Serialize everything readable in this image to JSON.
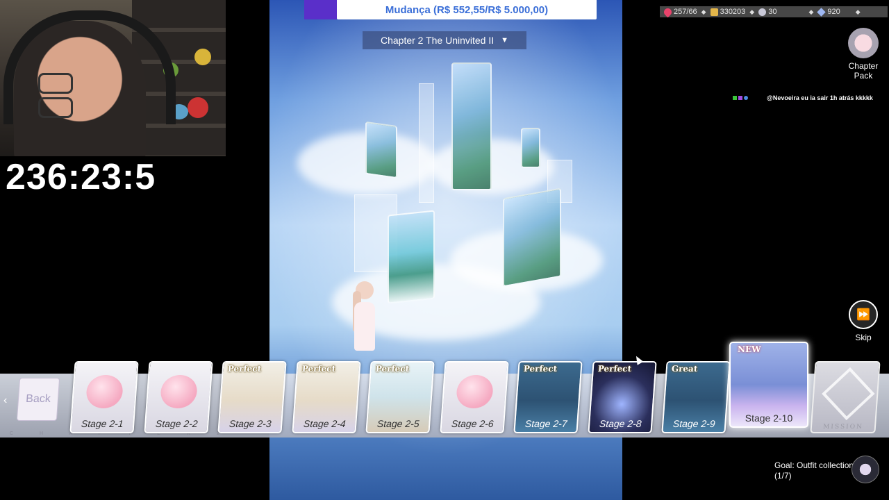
{
  "overlay": {
    "timer": "236:23:5",
    "donation_goal": "Mudança (R$ 552,55/R$ 5.000,00)",
    "chat_message": {
      "text": "@Nevoeira eu ia sair 1h atrás kkkkk"
    }
  },
  "game": {
    "chapter_selector": "Chapter 2 The Uninvited II",
    "resources": [
      {
        "icon": "heart-icon",
        "value": "257/66",
        "color": "#e8436b"
      },
      {
        "icon": "gold-coin-icon",
        "value": "330203",
        "color": "#e3b64a"
      },
      {
        "icon": "star-currency-icon",
        "value": "30",
        "color": "#c9c9d8"
      },
      {
        "icon": "diamond-icon",
        "value": "920",
        "color": "#9fb8f2"
      }
    ],
    "chapter_pack_label": "Chapter Pack",
    "skip_label": "Skip",
    "back_label": "Back",
    "chapter_strip": "C H A P T E R 2",
    "stages": [
      {
        "label": "Stage 2-1",
        "grade": "",
        "art": "pink-blob"
      },
      {
        "label": "Stage 2-2",
        "grade": "",
        "art": "pink-blob"
      },
      {
        "label": "Stage 2-3",
        "grade": "Perfect",
        "art": "room-light"
      },
      {
        "label": "Stage 2-4",
        "grade": "Perfect",
        "art": "room-light"
      },
      {
        "label": "Stage 2-5",
        "grade": "Perfect",
        "art": "room-sunny"
      },
      {
        "label": "Stage 2-6",
        "grade": "",
        "art": "pink-blob"
      },
      {
        "label": "Stage 2-7",
        "grade": "Perfect",
        "art": "room-night"
      },
      {
        "label": "Stage 2-8",
        "grade": "Perfect",
        "art": "space"
      },
      {
        "label": "Stage 2-9",
        "grade": "Great",
        "art": "room-night"
      }
    ],
    "new_stage": {
      "label": "Stage 2-10",
      "badge": "NEW"
    },
    "mission_label": "MISSION",
    "goal": {
      "title": "Goal: Outfit collection",
      "progress": "(1/7)"
    }
  },
  "colors": {
    "banner_text": "#3b6fd8",
    "banner_accent": "#5a2fc9"
  }
}
